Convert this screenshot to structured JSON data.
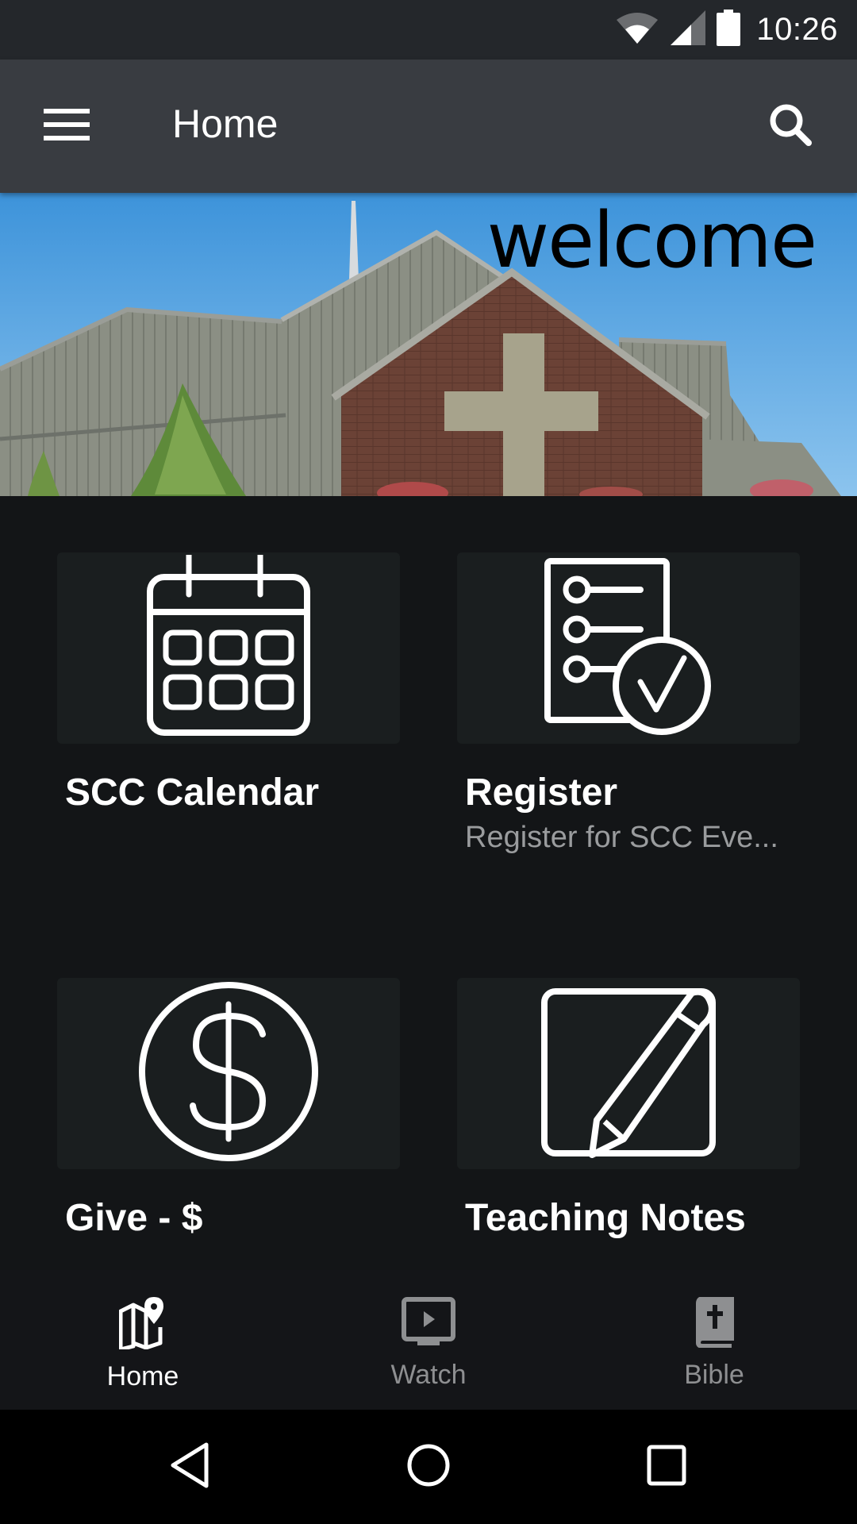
{
  "status_bar": {
    "time": "10:26",
    "icons": [
      "wifi-icon",
      "cell-signal-icon",
      "battery-icon"
    ]
  },
  "app_bar": {
    "title": "Home",
    "menu_icon": "hamburger-menu-icon",
    "search_icon": "search-icon"
  },
  "hero": {
    "text": "welcome",
    "image_description": "church building with brick facade and cross against blue sky"
  },
  "tiles": [
    {
      "label": "SCC Calendar",
      "subtitle": "",
      "icon": "calendar-icon"
    },
    {
      "label": "Register",
      "subtitle": "Register for SCC Eve...",
      "icon": "checklist-icon"
    },
    {
      "label": "Give - $",
      "subtitle": "",
      "icon": "dollar-circle-icon"
    },
    {
      "label": "Teaching Notes",
      "subtitle": "",
      "icon": "edit-note-icon"
    }
  ],
  "bottom_nav": {
    "items": [
      {
        "label": "Home",
        "icon": "map-pin-icon",
        "active": true
      },
      {
        "label": "Watch",
        "icon": "tv-play-icon",
        "active": false
      },
      {
        "label": "Bible",
        "icon": "bible-icon",
        "active": false
      }
    ]
  },
  "system_nav": {
    "back": "back-icon",
    "home": "home-circle-icon",
    "recents": "recents-icon"
  },
  "colors": {
    "status_bar": "#24272b",
    "app_bar": "#393c41",
    "background": "#131517",
    "card": "#1a1e1f",
    "subtitle": "#9a9c9e",
    "nav_inactive": "#8e8f91"
  }
}
